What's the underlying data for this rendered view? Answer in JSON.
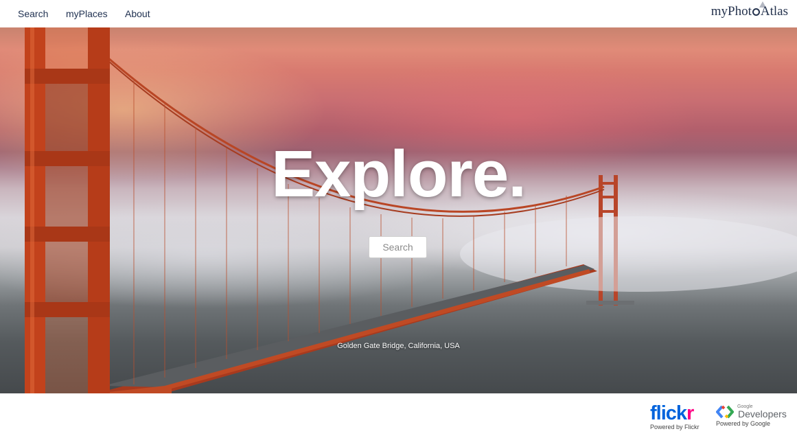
{
  "nav": {
    "links": [
      "Search",
      "myPlaces",
      "About"
    ],
    "logo": {
      "part1": "myPhot",
      "part2": "Atlas"
    }
  },
  "hero": {
    "title": "Explore.",
    "button_label": "Search",
    "caption": "Golden Gate Bridge, California, USA"
  },
  "footer": {
    "flickr": {
      "word_a": "flick",
      "word_b": "r",
      "powered": "Powered by Flickr"
    },
    "google": {
      "small": "Google",
      "word": "Developers",
      "powered": "Powered by Google"
    }
  },
  "colors": {
    "nav_text": "#1f3050",
    "bridge_orange": "#c0431f",
    "flickr_blue": "#0063dc",
    "flickr_pink": "#ff0084"
  }
}
